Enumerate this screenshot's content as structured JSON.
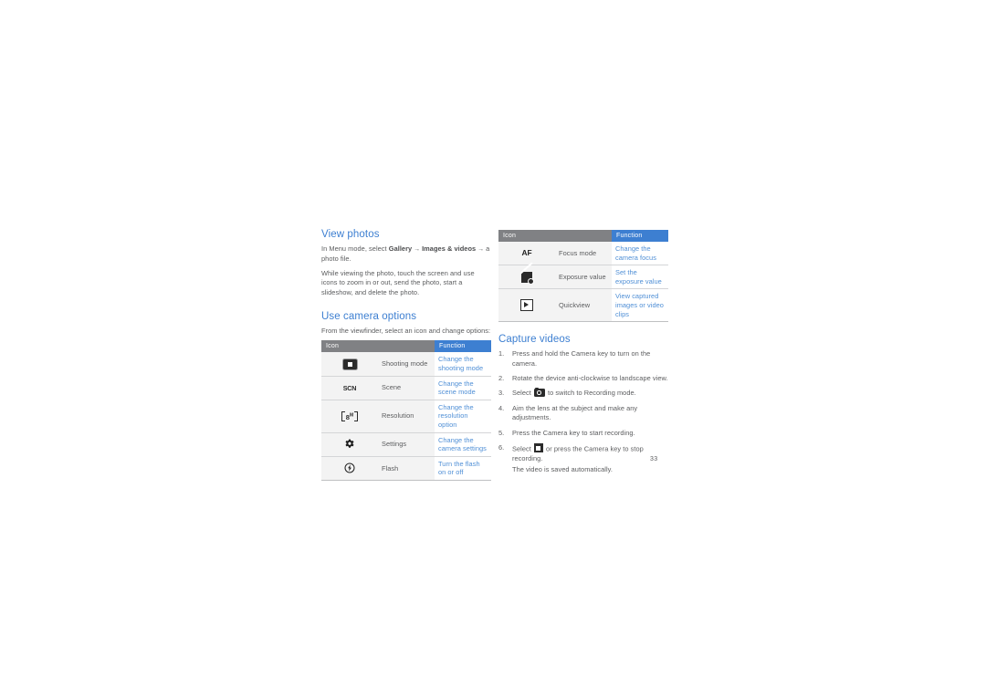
{
  "page": {
    "number": "33",
    "arrow_glyph": "→"
  },
  "left_column": {
    "view_photos": {
      "heading": "View photos",
      "para1_pre": "In Menu mode, select ",
      "para1_bold1": "Gallery",
      "para1_mid": " ",
      "para1_bold2": "Images &",
      "para1_bold3": "videos",
      "para1_post": " a photo file.",
      "para2": "While viewing the photo, touch the screen and use icons to zoom in or out, send the photo, start a slideshow, and delete the photo."
    },
    "use_camera_options": {
      "heading": "Use camera options",
      "intro": "From the viewfinder, select an icon and change options:",
      "table": {
        "columns": [
          "Icon",
          "Function"
        ],
        "rows": [
          {
            "icon": "shooting-mode-icon",
            "name": "Shooting mode",
            "function": "Change the shooting mode"
          },
          {
            "icon": "scn-scene-icon",
            "name": "Scene",
            "function": "Change the scene mode"
          },
          {
            "icon": "resolution-8m-icon",
            "name": "Resolution",
            "function": "Change the resolution option"
          },
          {
            "icon": "gear-settings-icon",
            "name": "Settings",
            "function": "Change the camera settings"
          },
          {
            "icon": "flash-icon",
            "name": "Flash",
            "function": "Turn the flash on or off"
          }
        ]
      }
    }
  },
  "right_column": {
    "table": {
      "columns": [
        "Icon",
        "Function"
      ],
      "rows": [
        {
          "icon": "af-focus-icon",
          "name": "Focus mode",
          "function": "Change the camera focus"
        },
        {
          "icon": "exposure-value-icon",
          "name": "Exposure value",
          "function": "Set the exposure value"
        },
        {
          "icon": "quickview-icon",
          "name": "Quickview",
          "function": "View captured images or video clips"
        }
      ]
    },
    "capture_videos": {
      "heading": "Capture videos",
      "steps": [
        {
          "text": "Press and hold the Camera key to turn on the camera."
        },
        {
          "text": "Rotate the device anti-clockwise to landscape view."
        },
        {
          "pre": "Select ",
          "icon": "camera-switch-icon",
          "post": " to switch to Recording mode."
        },
        {
          "text": "Aim the lens at the subject and make any adjustments."
        },
        {
          "text": "Press the Camera key to start recording."
        },
        {
          "pre": "Select ",
          "icon": "stop-recording-icon",
          "post": " or press the Camera key to stop recording.",
          "note": "The video is saved automatically."
        }
      ]
    }
  },
  "colors": {
    "heading_blue": "#3d7fd1",
    "function_text_blue": "#4f8fd6",
    "header_gray": "#808184",
    "body_text": "#5b5c5e",
    "row_bg": "#f3f3f3"
  }
}
